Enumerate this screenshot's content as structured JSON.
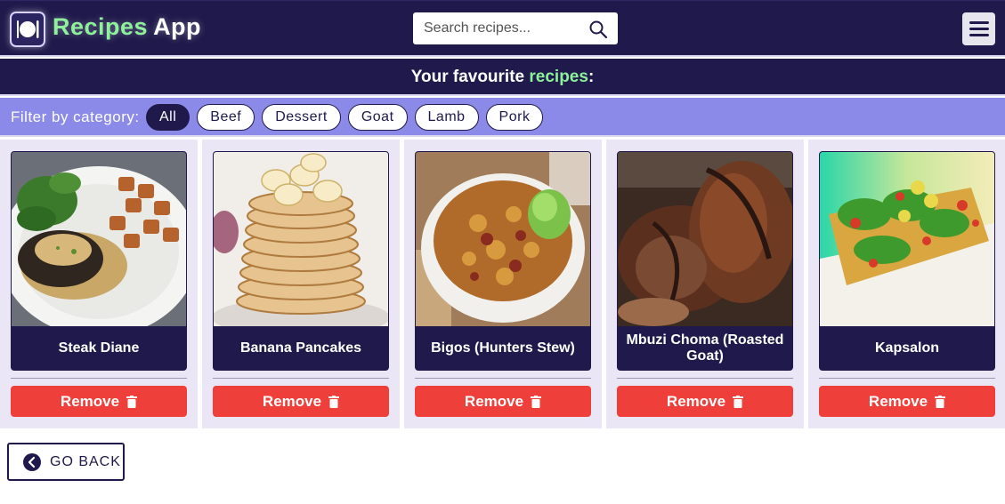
{
  "header": {
    "brand_part1": "Recipes",
    "brand_part2": "App",
    "search_placeholder": "Search recipes...",
    "icons": {
      "logo": "plate-cutlery-icon",
      "search": "search-icon",
      "menu": "hamburger-menu-icon"
    }
  },
  "titlebar": {
    "text_before": "Your favourite ",
    "highlight": "recipes",
    "text_after": ":"
  },
  "filter": {
    "label": "Filter by category:",
    "chips": [
      "All",
      "Beef",
      "Dessert",
      "Goat",
      "Lamb",
      "Pork"
    ],
    "active": "All"
  },
  "cards": [
    {
      "title": "Steak Diane",
      "remove_label": "Remove",
      "image": "steak-diane-photo"
    },
    {
      "title": "Banana Pancakes",
      "remove_label": "Remove",
      "image": "banana-pancakes-photo"
    },
    {
      "title": "Bigos (Hunters Stew)",
      "remove_label": "Remove",
      "image": "bigos-photo"
    },
    {
      "title": "Mbuzi Choma (Roasted Goat)",
      "remove_label": "Remove",
      "image": "mbuzi-choma-photo"
    },
    {
      "title": "Kapsalon",
      "remove_label": "Remove",
      "image": "kapsalon-photo"
    }
  ],
  "go_back": {
    "label": "GO BACK",
    "icon": "chevron-left-circle-icon"
  },
  "colors": {
    "navy": "#1f1a4b",
    "green": "#8ef09a",
    "filter_bg": "#8c8ae8",
    "card_bg": "#ebe6f5",
    "remove_red": "#ef3f3a"
  }
}
